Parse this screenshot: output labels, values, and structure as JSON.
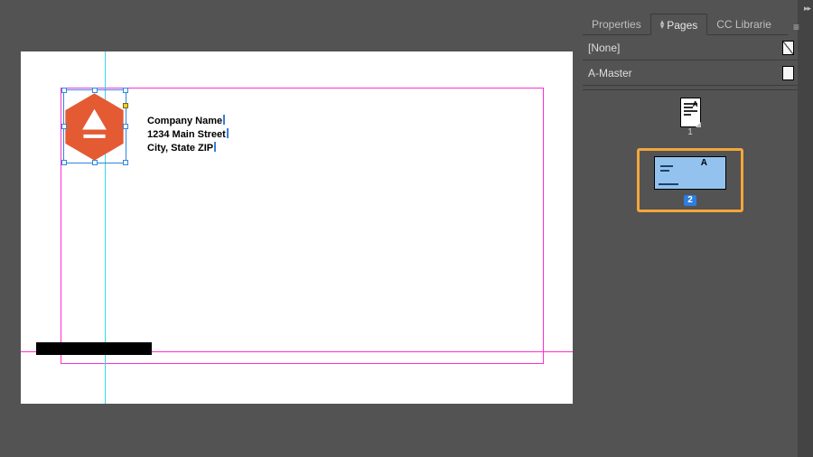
{
  "panel": {
    "tabs": {
      "properties": "Properties",
      "pages": "Pages",
      "cc": "CC Librarie"
    },
    "masters": {
      "none": "[None]",
      "a_master": "A-Master"
    },
    "pages": {
      "page1_badge": "A",
      "page1_num": "1",
      "page2_badge": "A",
      "page2_num": "2"
    }
  },
  "document": {
    "address": {
      "line1": "Company Name",
      "line2": "1234 Main Street",
      "line3": "City, State ZIP"
    }
  },
  "colors": {
    "logo": "#e35a33",
    "highlight": "#f3a63b",
    "selected_page": "#93c2ee"
  }
}
